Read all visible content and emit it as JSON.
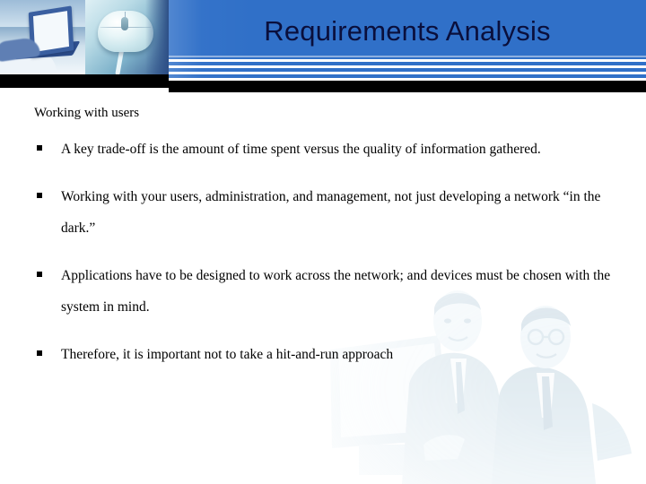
{
  "slide": {
    "title": "Requirements Analysis",
    "lead": "Working with users",
    "bullets": [
      "A key trade-off is the amount of time spent versus the quality of information gathered.",
      "Working with your users, administration, and management, not just developing a network “in the dark.”",
      "Applications have to be designed to work across the network; and devices must be chosen with the system in mind.",
      "Therefore, it is important not to take a hit-and-run approach"
    ],
    "bullet_marker": "square-bullet-icon",
    "header_images": [
      "laptop-photo",
      "computer-mouse-photo"
    ],
    "background_image": "businessmen-at-monitor-watermark",
    "colors": {
      "header_blue": "#3070c8",
      "header_stripe": "#ffffff",
      "header_rule_black": "#000000",
      "title_text": "#0a0f3c",
      "body_text": "#000000",
      "slide_background": "#ffffff"
    }
  }
}
